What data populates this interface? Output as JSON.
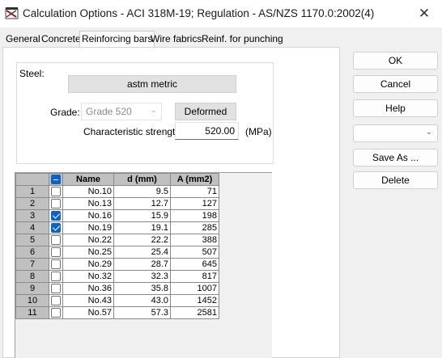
{
  "window": {
    "title": "Calculation Options - ACI 318M-19;   Regulation - AS/NZS 1170.0:2002(4)",
    "close_glyph": "✕"
  },
  "tabs": [
    {
      "label": "General",
      "active": false
    },
    {
      "label": "Concrete",
      "active": false
    },
    {
      "label": "Reinforcing bars",
      "active": true
    },
    {
      "label": "Wire fabrics",
      "active": false
    },
    {
      "label": "Reinf. for punching",
      "active": false
    }
  ],
  "steel": {
    "group_label": "Steel:",
    "standard_button": "astm metric",
    "grade_label": "Grade:",
    "grade_value": "Grade 520",
    "bar_type_button": "Deformed",
    "strength_label": "Characteristic strength",
    "strength_value": "520.00",
    "strength_unit": "(MPa)"
  },
  "grid": {
    "columns": [
      "",
      "",
      "Name",
      "d (mm)",
      "A (mm2)"
    ],
    "header_checkbox": "partial",
    "rows": [
      {
        "num": "1",
        "checked": false,
        "name": "No.10",
        "d": "9.5",
        "a": "71"
      },
      {
        "num": "2",
        "checked": false,
        "name": "No.13",
        "d": "12.7",
        "a": "127"
      },
      {
        "num": "3",
        "checked": true,
        "name": "No.16",
        "d": "15.9",
        "a": "198"
      },
      {
        "num": "4",
        "checked": true,
        "name": "No.19",
        "d": "19.1",
        "a": "285"
      },
      {
        "num": "5",
        "checked": false,
        "name": "No.22",
        "d": "22.2",
        "a": "388"
      },
      {
        "num": "6",
        "checked": false,
        "name": "No.25",
        "d": "25.4",
        "a": "507"
      },
      {
        "num": "7",
        "checked": false,
        "name": "No.29",
        "d": "28.7",
        "a": "645"
      },
      {
        "num": "8",
        "checked": false,
        "name": "No.32",
        "d": "32.3",
        "a": "817"
      },
      {
        "num": "9",
        "checked": false,
        "name": "No.36",
        "d": "35.8",
        "a": "1007"
      },
      {
        "num": "10",
        "checked": false,
        "name": "No.43",
        "d": "43.0",
        "a": "1452"
      },
      {
        "num": "11",
        "checked": false,
        "name": "No.57",
        "d": "57.3",
        "a": "2581"
      }
    ]
  },
  "side": {
    "ok": "OK",
    "cancel": "Cancel",
    "help": "Help",
    "preset_value": "",
    "save_as": "Save As ...",
    "delete": "Delete"
  },
  "colors": {
    "checkbox_checked": "#0a64c8",
    "grid_header": "#c0c0c0"
  }
}
